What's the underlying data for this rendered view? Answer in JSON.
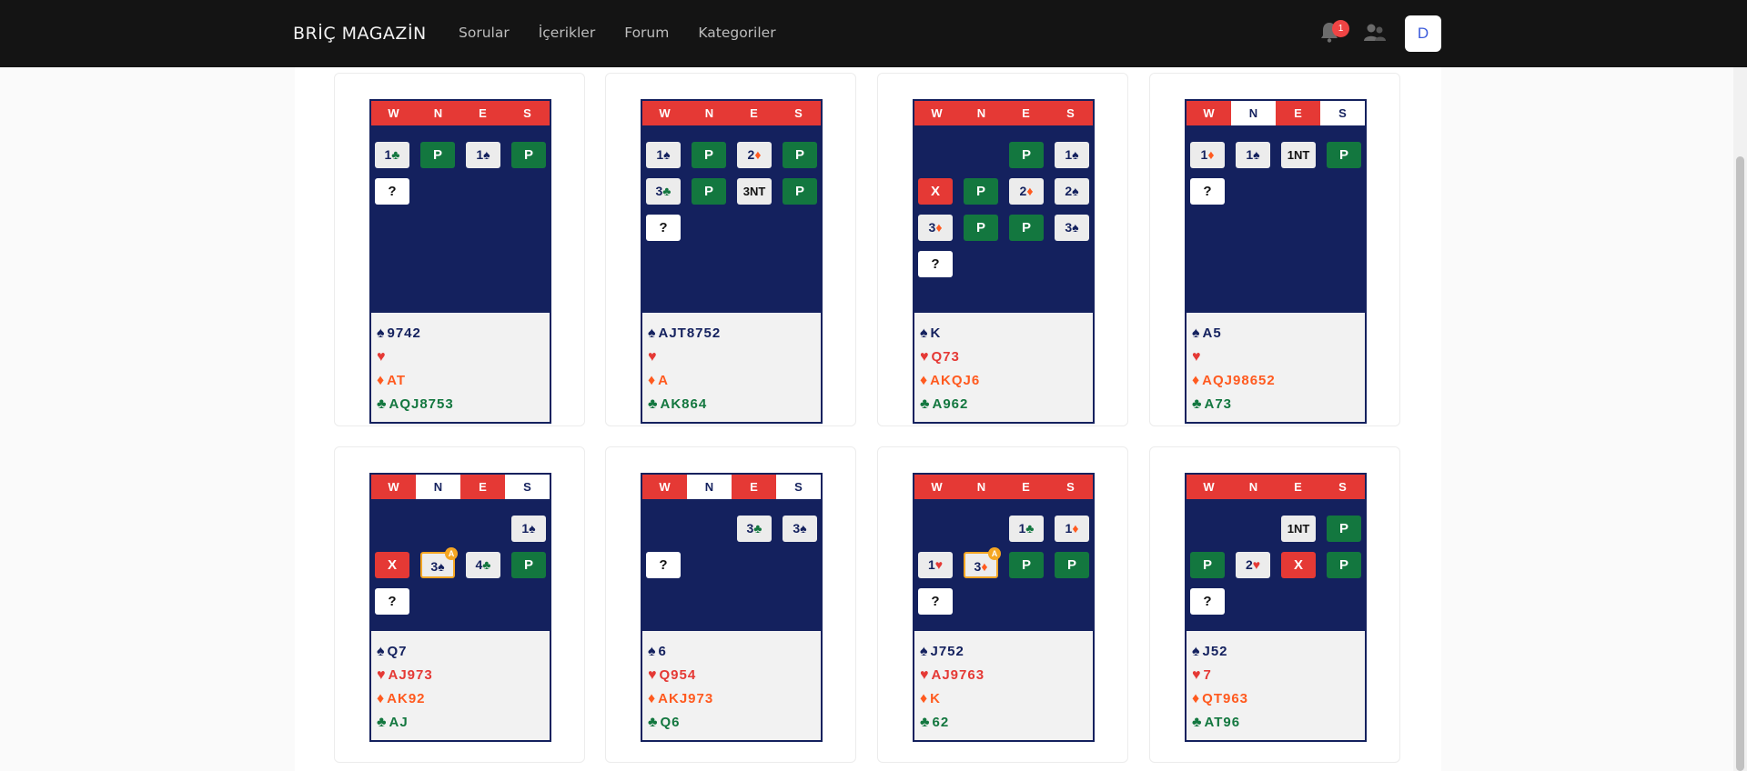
{
  "nav": {
    "logo": "BRİÇ MAGAZİN",
    "links": [
      "Sorular",
      "İçerikler",
      "Forum",
      "Kategoriler"
    ],
    "notification_count": "1",
    "avatar_letter": "D"
  },
  "icons": {
    "bell": "bell-icon",
    "users": "users-icon",
    "spade": "♠",
    "heart": "♥",
    "diamond": "♦",
    "club": "♣"
  },
  "colors": {
    "vul": "#e53935",
    "board": "#14215e",
    "pass": "#13773f",
    "alert": "#f5a623"
  },
  "header": [
    "W",
    "N",
    "E",
    "S"
  ],
  "boards": [
    {
      "vul": [
        true,
        true,
        true,
        true
      ],
      "rows": [
        [
          {
            "t": "1♣",
            "k": "call",
            "s": "cl"
          },
          {
            "t": "P",
            "k": "pass"
          },
          {
            "t": "1♠",
            "k": "call",
            "s": "sp"
          },
          {
            "t": "P",
            "k": "pass"
          }
        ],
        [
          {
            "t": "?",
            "k": "q"
          },
          null,
          null,
          null
        ]
      ],
      "hand": {
        "spades": "9742",
        "hearts": "",
        "diamonds": "AT",
        "clubs": "AQJ8753"
      }
    },
    {
      "vul": [
        true,
        true,
        true,
        true
      ],
      "rows": [
        [
          {
            "t": "1♠",
            "k": "call",
            "s": "sp"
          },
          {
            "t": "P",
            "k": "pass"
          },
          {
            "t": "2♦",
            "k": "call",
            "s": "di"
          },
          {
            "t": "P",
            "k": "pass"
          }
        ],
        [
          {
            "t": "3♣",
            "k": "call",
            "s": "cl"
          },
          {
            "t": "P",
            "k": "pass"
          },
          {
            "t": "3NT",
            "k": "call",
            "s": "nt"
          },
          {
            "t": "P",
            "k": "pass"
          }
        ],
        [
          {
            "t": "?",
            "k": "q"
          },
          null,
          null,
          null
        ]
      ],
      "hand": {
        "spades": "AJT8752",
        "hearts": "",
        "diamonds": "A",
        "clubs": "AK864"
      }
    },
    {
      "vul": [
        true,
        true,
        true,
        true
      ],
      "rows": [
        [
          null,
          null,
          {
            "t": "P",
            "k": "pass"
          },
          {
            "t": "1♠",
            "k": "call",
            "s": "sp"
          }
        ],
        [
          {
            "t": "X",
            "k": "dbl"
          },
          {
            "t": "P",
            "k": "pass"
          },
          {
            "t": "2♦",
            "k": "call",
            "s": "di"
          },
          {
            "t": "2♠",
            "k": "call",
            "s": "sp"
          }
        ],
        [
          {
            "t": "3♦",
            "k": "call",
            "s": "di"
          },
          {
            "t": "P",
            "k": "pass"
          },
          {
            "t": "P",
            "k": "pass"
          },
          {
            "t": "3♠",
            "k": "call",
            "s": "sp"
          }
        ],
        [
          {
            "t": "?",
            "k": "q"
          },
          null,
          null,
          null
        ]
      ],
      "hand": {
        "spades": "K",
        "hearts": "Q73",
        "diamonds": "AKQJ6",
        "clubs": "A962"
      }
    },
    {
      "vul": [
        true,
        false,
        true,
        false
      ],
      "rows": [
        [
          {
            "t": "1♦",
            "k": "call",
            "s": "di"
          },
          {
            "t": "1♠",
            "k": "call",
            "s": "sp"
          },
          {
            "t": "1NT",
            "k": "call",
            "s": "nt"
          },
          {
            "t": "P",
            "k": "pass"
          }
        ],
        [
          {
            "t": "?",
            "k": "q"
          },
          null,
          null,
          null
        ]
      ],
      "hand": {
        "spades": "A5",
        "hearts": "",
        "diamonds": "AQJ98652",
        "clubs": "A73"
      }
    },
    {
      "vul": [
        true,
        false,
        true,
        false
      ],
      "rows": [
        [
          null,
          null,
          null,
          {
            "t": "1♠",
            "k": "call",
            "s": "sp"
          }
        ],
        [
          {
            "t": "X",
            "k": "dbl"
          },
          {
            "t": "3♠",
            "k": "call",
            "s": "sp",
            "alert": "A"
          },
          {
            "t": "4♣",
            "k": "call",
            "s": "cl"
          },
          {
            "t": "P",
            "k": "pass"
          }
        ],
        [
          {
            "t": "?",
            "k": "q"
          },
          null,
          null,
          null
        ]
      ],
      "hand": {
        "spades": "Q7",
        "hearts": "AJ973",
        "diamonds": "AK92",
        "clubs": "AJ"
      }
    },
    {
      "vul": [
        true,
        false,
        true,
        false
      ],
      "rows": [
        [
          null,
          null,
          {
            "t": "3♣",
            "k": "call",
            "s": "cl"
          },
          {
            "t": "3♠",
            "k": "call",
            "s": "sp"
          }
        ],
        [
          {
            "t": "?",
            "k": "q"
          },
          null,
          null,
          null
        ]
      ],
      "hand": {
        "spades": "6",
        "hearts": "Q954",
        "diamonds": "AKJ973",
        "clubs": "Q6"
      }
    },
    {
      "vul": [
        true,
        true,
        true,
        true
      ],
      "rows": [
        [
          null,
          null,
          {
            "t": "1♣",
            "k": "call",
            "s": "cl"
          },
          {
            "t": "1♦",
            "k": "call",
            "s": "di"
          }
        ],
        [
          {
            "t": "1♥",
            "k": "call",
            "s": "he"
          },
          {
            "t": "3♦",
            "k": "call",
            "s": "di",
            "alert": "A"
          },
          {
            "t": "P",
            "k": "pass"
          },
          {
            "t": "P",
            "k": "pass"
          }
        ],
        [
          {
            "t": "?",
            "k": "q"
          },
          null,
          null,
          null
        ]
      ],
      "hand": {
        "spades": "J752",
        "hearts": "AJ9763",
        "diamonds": "K",
        "clubs": "62"
      }
    },
    {
      "vul": [
        true,
        true,
        true,
        true
      ],
      "rows": [
        [
          null,
          null,
          {
            "t": "1NT",
            "k": "call",
            "s": "nt"
          },
          {
            "t": "P",
            "k": "pass"
          }
        ],
        [
          {
            "t": "P",
            "k": "pass"
          },
          {
            "t": "2♥",
            "k": "call",
            "s": "he"
          },
          {
            "t": "X",
            "k": "dbl"
          },
          {
            "t": "P",
            "k": "pass"
          }
        ],
        [
          {
            "t": "?",
            "k": "q"
          },
          null,
          null,
          null
        ]
      ],
      "hand": {
        "spades": "J52",
        "hearts": "7",
        "diamonds": "QT963",
        "clubs": "AT96"
      }
    }
  ]
}
